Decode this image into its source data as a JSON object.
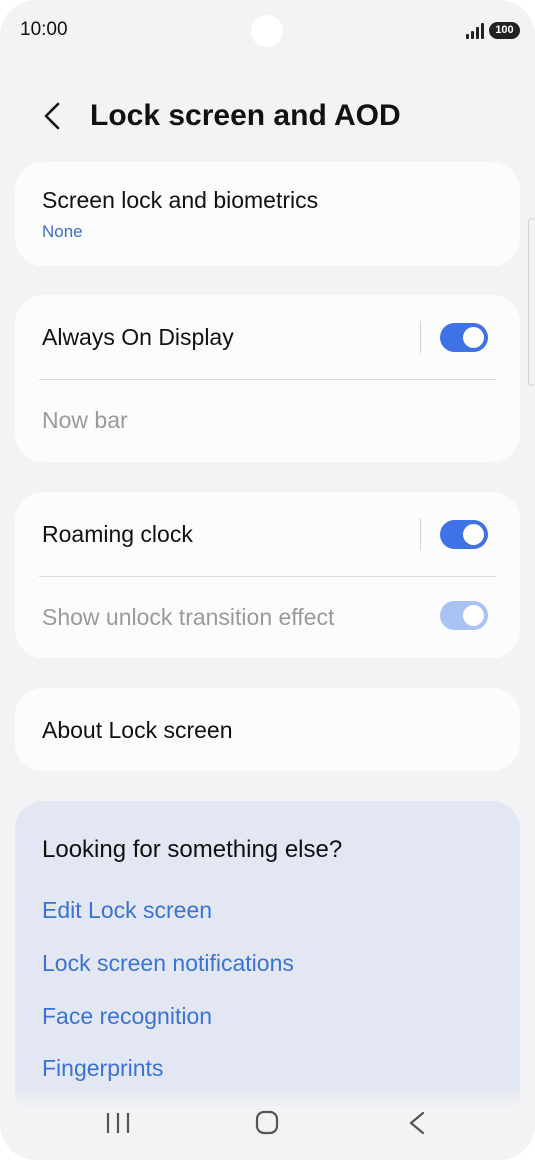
{
  "status_bar": {
    "time": "10:00",
    "battery": "100"
  },
  "header": {
    "title": "Lock screen and AOD"
  },
  "screen_lock": {
    "label": "Screen lock and biometrics",
    "value": "None"
  },
  "display_card": {
    "always_on_display": {
      "label": "Always On Display",
      "enabled": true
    },
    "now_bar": {
      "label": "Now bar"
    }
  },
  "clock_card": {
    "roaming_clock": {
      "label": "Roaming clock",
      "enabled": true
    },
    "unlock_effect": {
      "label": "Show unlock transition effect",
      "enabled": true,
      "disabled": true
    }
  },
  "about": {
    "label": "About Lock screen"
  },
  "suggestions": {
    "title": "Looking for something else?",
    "links": [
      "Edit Lock screen",
      "Lock screen notifications",
      "Face recognition",
      "Fingerprints"
    ]
  },
  "colors": {
    "accent": "#3e72e6",
    "link": "#3a73d6",
    "background": "#f3f3f5"
  },
  "nav_icons": [
    "recents-icon",
    "home-icon",
    "back-icon"
  ]
}
